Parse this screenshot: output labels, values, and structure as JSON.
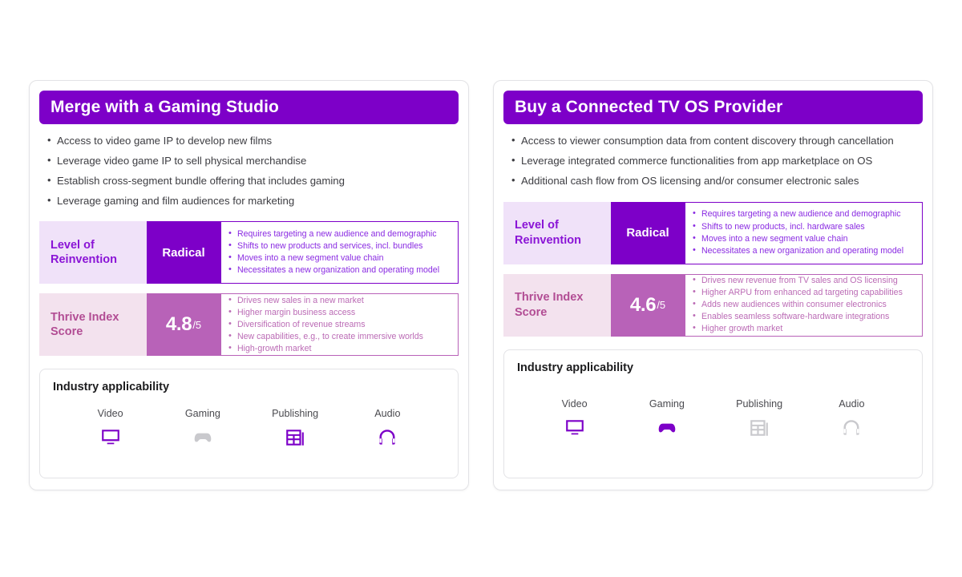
{
  "cards": [
    {
      "title": "Merge with a Gaming Studio",
      "bullets": [
        "Access to video game IP to develop new films",
        "Leverage video game IP to sell physical merchandise",
        "Establish cross-segment bundle offering that includes gaming",
        "Leverage gaming and film audiences for marketing"
      ],
      "reinvention": {
        "label": "Level of Reinvention",
        "value": "Radical",
        "details": [
          "Requires targeting a new audience and demographic",
          "Shifts to new products and services, incl. bundles",
          "Moves into a new segment value chain",
          "Necessitates a new organization and operating model"
        ]
      },
      "thrive": {
        "label": "Thrive Index Score",
        "score": "4.8",
        "denominator": "/5",
        "details": [
          "Drives new sales in a new market",
          "Higher margin business access",
          "Diversification of revenue streams",
          "New capabilities, e.g., to create immersive worlds",
          "High-growth market"
        ]
      },
      "industry": {
        "title": "Industry applicability",
        "items": [
          {
            "label": "Video",
            "icon": "tv-icon",
            "active": true
          },
          {
            "label": "Gaming",
            "icon": "gamepad-icon",
            "active": false
          },
          {
            "label": "Publishing",
            "icon": "newspaper-icon",
            "active": true
          },
          {
            "label": "Audio",
            "icon": "headphones-icon",
            "active": true
          }
        ]
      }
    },
    {
      "title": "Buy a Connected TV OS Provider",
      "bullets": [
        "Access to viewer consumption data from content discovery through cancellation",
        "Leverage integrated commerce functionalities from app marketplace on OS",
        "Additional cash flow from OS licensing and/or consumer electronic sales"
      ],
      "reinvention": {
        "label": "Level of Reinvention",
        "value": "Radical",
        "details": [
          "Requires targeting a new audience and demographic",
          "Shifts to new products, incl. hardware sales",
          "Moves into a new segment value chain",
          "Necessitates a new organization and operating model"
        ]
      },
      "thrive": {
        "label": "Thrive Index Score",
        "score": "4.6",
        "denominator": "/5",
        "details": [
          "Drives new revenue from TV sales and OS licensing",
          "Higher ARPU from enhanced ad targeting capabilities",
          "Adds new audiences within consumer electronics",
          "Enables seamless software-hardware integrations",
          "Higher growth market"
        ]
      },
      "industry": {
        "title": "Industry applicability",
        "items": [
          {
            "label": "Video",
            "icon": "tv-icon",
            "active": true
          },
          {
            "label": "Gaming",
            "icon": "gamepad-icon",
            "active": true
          },
          {
            "label": "Publishing",
            "icon": "newspaper-icon",
            "active": false
          },
          {
            "label": "Audio",
            "icon": "headphones-icon",
            "active": false
          }
        ]
      }
    }
  ],
  "colors": {
    "header_purple": "#7d00c8",
    "reinvention_text": "#8a2be2",
    "thrive_block": "#b862b8",
    "thrive_text": "#bb6bb5",
    "label_tint_reinvention": "#f0e2f9",
    "label_tint_thrive": "#f3e2ee",
    "icon_active": "#7d00c8",
    "icon_inactive": "#c9c9cd"
  }
}
